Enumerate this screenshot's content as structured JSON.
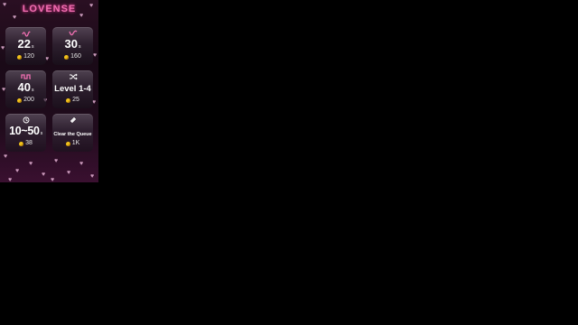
{
  "app": {
    "logo_text": "LOVENSE"
  },
  "cards": [
    {
      "icon": "wave-low-icon",
      "value": "22",
      "unit": "s",
      "price": "120"
    },
    {
      "icon": "wave-medium-icon",
      "value": "30",
      "unit": "s",
      "price": "160"
    },
    {
      "icon": "wave-high-icon",
      "value": "40",
      "unit": "s",
      "price": "200"
    },
    {
      "icon": "shuffle-icon",
      "value": "Level 1-4",
      "unit": "",
      "price": "25"
    },
    {
      "icon": "clock-icon",
      "value": "10~50",
      "unit": "s",
      "price": "38"
    },
    {
      "icon": "eraser-icon",
      "value": "Clear the Queue",
      "unit": "",
      "price": "1K"
    }
  ],
  "colors": {
    "background": "#000000",
    "panel": "#1a0a17",
    "brand_pink": "#f06fb1",
    "coin": "#f2c21b",
    "hearts": "#e6b3d6"
  }
}
